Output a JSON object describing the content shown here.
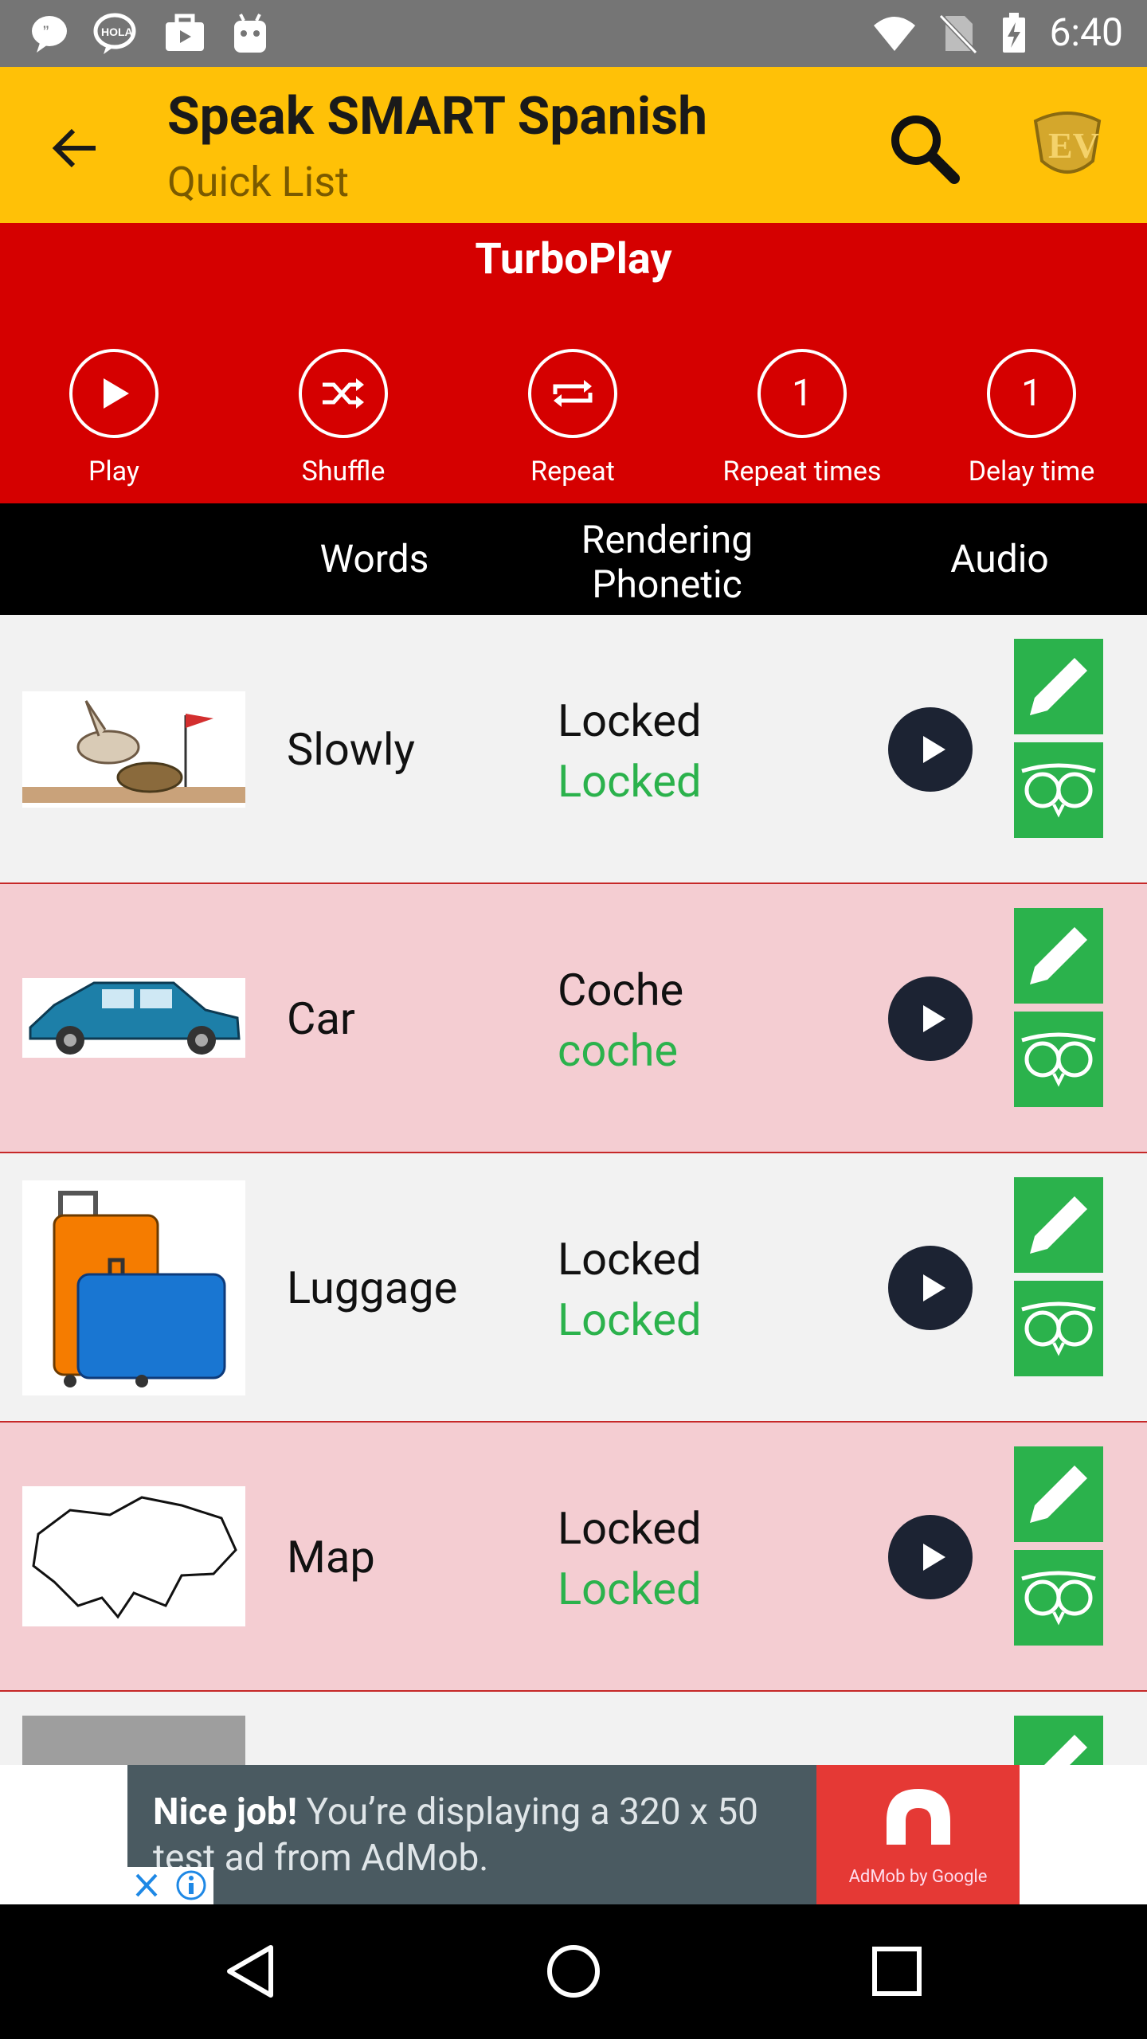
{
  "status_bar": {
    "time": "6:40",
    "icons_left": [
      "chat-icon",
      "hola-icon",
      "briefcase-icon",
      "android-icon"
    ],
    "icons_right": [
      "wifi-icon",
      "no-sim-icon",
      "battery-charging-icon"
    ]
  },
  "app_bar": {
    "title": "Speak SMART Spanish",
    "subtitle": "Quick List"
  },
  "turboplay": {
    "title": "TurboPlay",
    "buttons": [
      {
        "label": "Play",
        "icon": "play-icon"
      },
      {
        "label": "Shuffle",
        "icon": "shuffle-icon"
      },
      {
        "label": "Repeat",
        "icon": "repeat-icon"
      },
      {
        "label": "Repeat times",
        "value": "1"
      },
      {
        "label": "Delay time",
        "value": "1"
      }
    ]
  },
  "columns": {
    "words": "Words",
    "rendering_line1": "Rendering",
    "rendering_line2": "Phonetic",
    "audio": "Audio"
  },
  "rows": [
    {
      "word": "Slowly",
      "rendering": "Locked",
      "phonetic": "Locked",
      "image": "rabbit-and-turtle"
    },
    {
      "word": "Car",
      "rendering": "Coche",
      "phonetic": "coche",
      "image": "blue-car"
    },
    {
      "word": "Luggage",
      "rendering": "Locked",
      "phonetic": "Locked",
      "image": "suitcases"
    },
    {
      "word": "Map",
      "rendering": "Locked",
      "phonetic": "Locked",
      "image": "map-outline"
    }
  ],
  "ad": {
    "text_bold": "Nice job!",
    "text_rest": " You’re displaying a 320 x 50 test ad from AdMob.",
    "brand": "AdMob by Google"
  },
  "colors": {
    "app_bar": "#ffc107",
    "turboplay": "#d50000",
    "green": "#2bb24c",
    "pink_row": "#f4cdd2"
  }
}
